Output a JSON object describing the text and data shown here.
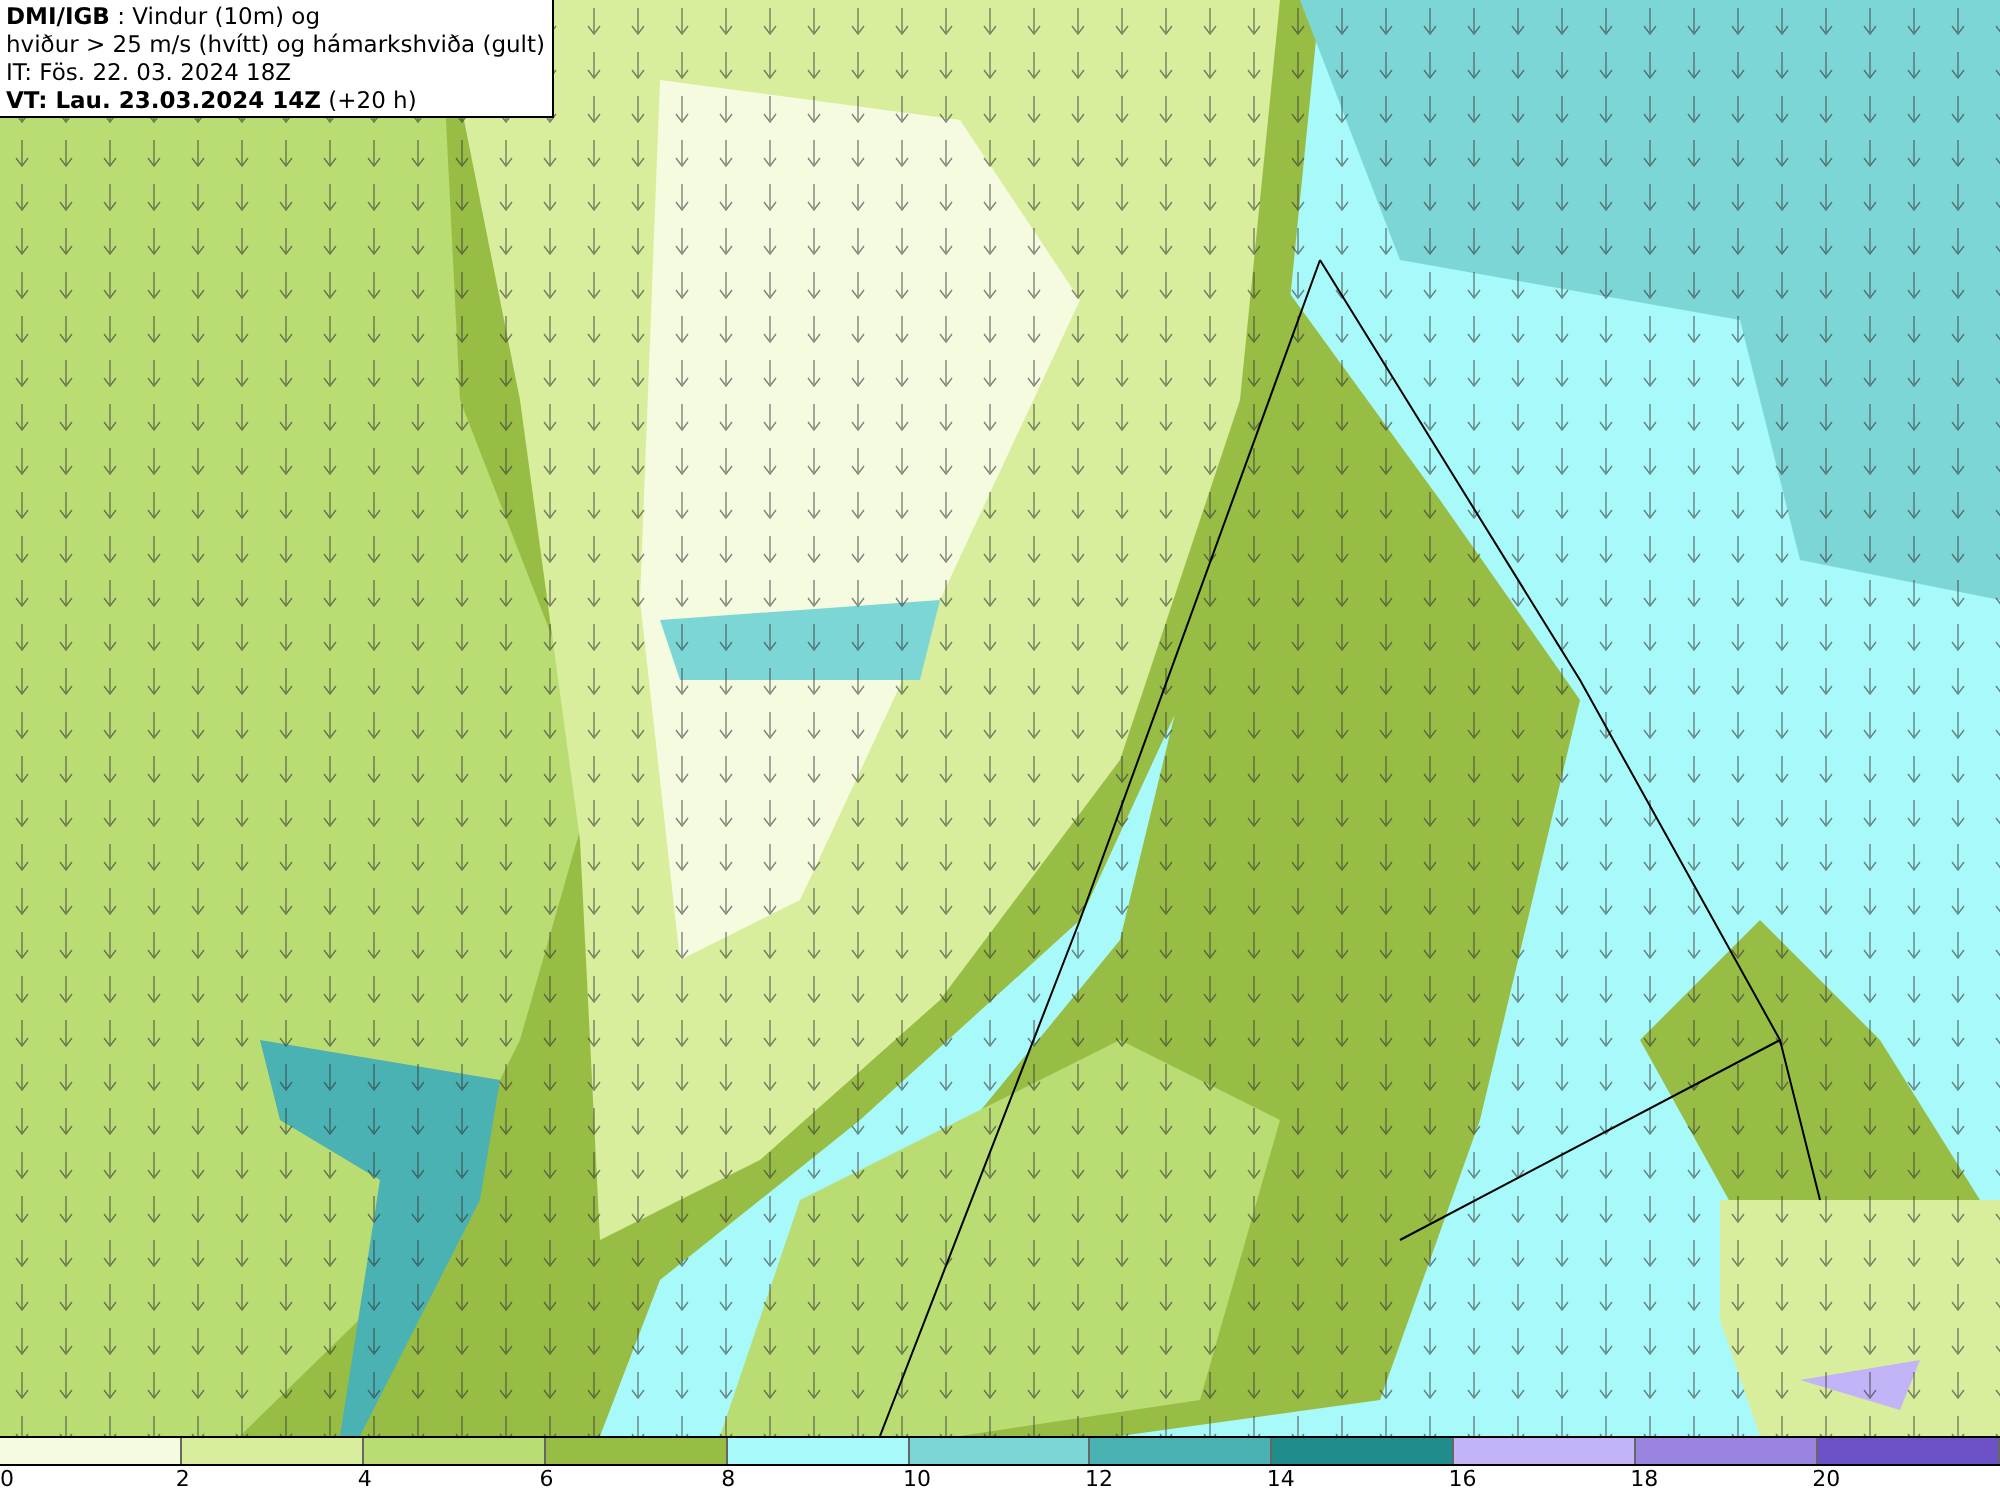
{
  "title_box": {
    "lines": [
      "**DMI/IGB** : Vindur (10m) og",
      "hviður > 25 m/s (hvítt) og hámarkshviða (gult)",
      "IT: Fös. 22. 03. 2024 18Z",
      "**VT: Lau. 23.03.2024 14Z** (+20 h)"
    ]
  },
  "legend": {
    "bins": [
      {
        "color": "#f5fbdf",
        "label": "0"
      },
      {
        "color": "#d8ee9c",
        "label": "2"
      },
      {
        "color": "#b9dc73",
        "label": "4"
      },
      {
        "color": "#98bd45",
        "label": "6"
      },
      {
        "color": "#a8fafa",
        "label": "8"
      },
      {
        "color": "#7dd6d6",
        "label": "10"
      },
      {
        "color": "#4ab2b2",
        "label": "12"
      },
      {
        "color": "#218c8c",
        "label": "14"
      },
      {
        "color": "#c3b4f7",
        "label": "16"
      },
      {
        "color": "#9a84e0",
        "label": "18"
      },
      {
        "color": "#6c51c7",
        "label": "20"
      }
    ]
  }
}
